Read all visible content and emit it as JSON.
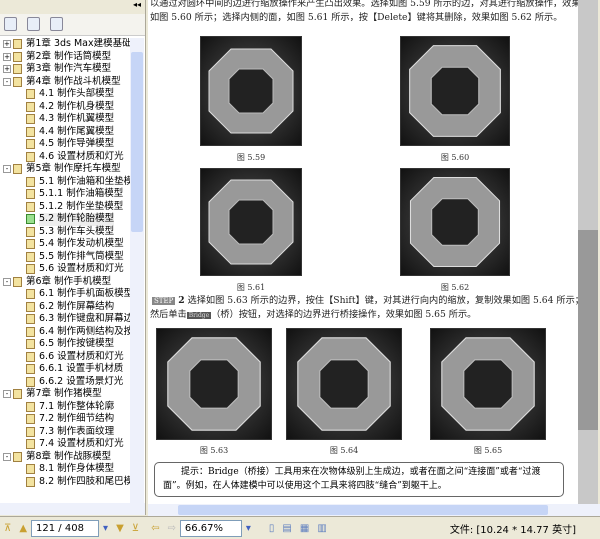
{
  "sidebar": {
    "collapse_icon": "◂◂",
    "tools": [
      "delete-bookmark-icon",
      "new-bookmark-icon",
      "bookmark-properties-icon"
    ],
    "items": [
      {
        "label": "第1章 3ds Max建模基础",
        "level": 0,
        "exp": "+"
      },
      {
        "label": "第2章 制作话筒模型",
        "level": 0,
        "exp": "+"
      },
      {
        "label": "第3章 制作汽车模型",
        "level": 0,
        "exp": "+"
      },
      {
        "label": "第4章 制作战斗机模型",
        "level": 0,
        "exp": "-"
      },
      {
        "label": "4.1 制作头部模型",
        "level": 1
      },
      {
        "label": "4.2 制作机身模型",
        "level": 1
      },
      {
        "label": "4.3 制作机翼模型",
        "level": 1
      },
      {
        "label": "4.4 制作尾翼模型",
        "level": 1
      },
      {
        "label": "4.5 制作导弹模型",
        "level": 1
      },
      {
        "label": "4.6 设置材质和灯光",
        "level": 1
      },
      {
        "label": "第5章 制作摩托车模型",
        "level": 0,
        "exp": "-"
      },
      {
        "label": "5.1 制作油箱和坐垫模",
        "level": 1
      },
      {
        "label": "5.1.1 制作油箱模型",
        "level": 1
      },
      {
        "label": "5.1.2 制作坐垫模型",
        "level": 1
      },
      {
        "label": "5.2 制作轮胎模型",
        "level": 1,
        "selected": true
      },
      {
        "label": "5.3 制作车头模型",
        "level": 1
      },
      {
        "label": "5.4 制作发动机模型",
        "level": 1
      },
      {
        "label": "5.5 制作排气筒模型",
        "level": 1
      },
      {
        "label": "5.6 设置材质和灯光",
        "level": 1
      },
      {
        "label": "第6章 制作手机模型",
        "level": 0,
        "exp": "-"
      },
      {
        "label": "6.1 制作手机面板模型",
        "level": 1
      },
      {
        "label": "6.2 制作屏幕结构",
        "level": 1
      },
      {
        "label": "6.3 制作键盘和屏幕边",
        "level": 1
      },
      {
        "label": "6.4 制作两侧结构及按",
        "level": 1
      },
      {
        "label": "6.5 制作按键模型",
        "level": 1
      },
      {
        "label": "6.6 设置材质和灯光",
        "level": 1
      },
      {
        "label": "6.6.1 设置手机材质",
        "level": 1
      },
      {
        "label": "6.6.2 设置场景灯光",
        "level": 1
      },
      {
        "label": "第7章 制作猪模型",
        "level": 0,
        "exp": "-"
      },
      {
        "label": "7.1 制作整体轮廓",
        "level": 1
      },
      {
        "label": "7.2 制作细节结构",
        "level": 1
      },
      {
        "label": "7.3 制作表面纹理",
        "level": 1
      },
      {
        "label": "7.4 设置材质和灯光",
        "level": 1
      },
      {
        "label": "第8章 制作战豚模型",
        "level": 0,
        "exp": "-"
      },
      {
        "label": "8.1 制作身体模型",
        "level": 1
      },
      {
        "label": "8.2 制作四肢和尾巴模",
        "level": 1
      }
    ]
  },
  "doc": {
    "para1": [
      "以通过对圆环中间的边进行缩放操作来产生凸出效果。选择如图 5.59 所示的边，对其进行缩放操作，效果",
      "如图 5.60 所示；选择内侧的面，如图 5.61 所示，按【Delete】键将其删除，效果如图 5.62 所示。"
    ],
    "step_label": "STEP",
    "step_num": "2",
    "para2a": "选择如图 5.63 所示的边界，按住【Shift】键，对其进行向内的缩放，复制效果如图 5.64 所示；",
    "para2b_pre": "然后单击",
    "bridge_btn": "Bridge",
    "para2b_post": "（桥）按钮，对选择的边界进行桥接操作，效果如图 5.65 所示。",
    "captions": [
      "图 5.59",
      "图 5.60",
      "图 5.61",
      "图 5.62",
      "图 5.63",
      "图 5.64",
      "图 5.65"
    ],
    "tip": [
      "提示：Bridge（桥接）工具用来在次物体级别上生成边，或者在面之间“连接面”或者“过渡",
      "面”。例如，在人体建模中可以使用这个工具来将四肢“缝合”到躯干上。"
    ]
  },
  "status": {
    "page": "121 / 408",
    "zoom": "66.67%",
    "file_info": "文件: [10.24 * 14.77 英寸]"
  }
}
